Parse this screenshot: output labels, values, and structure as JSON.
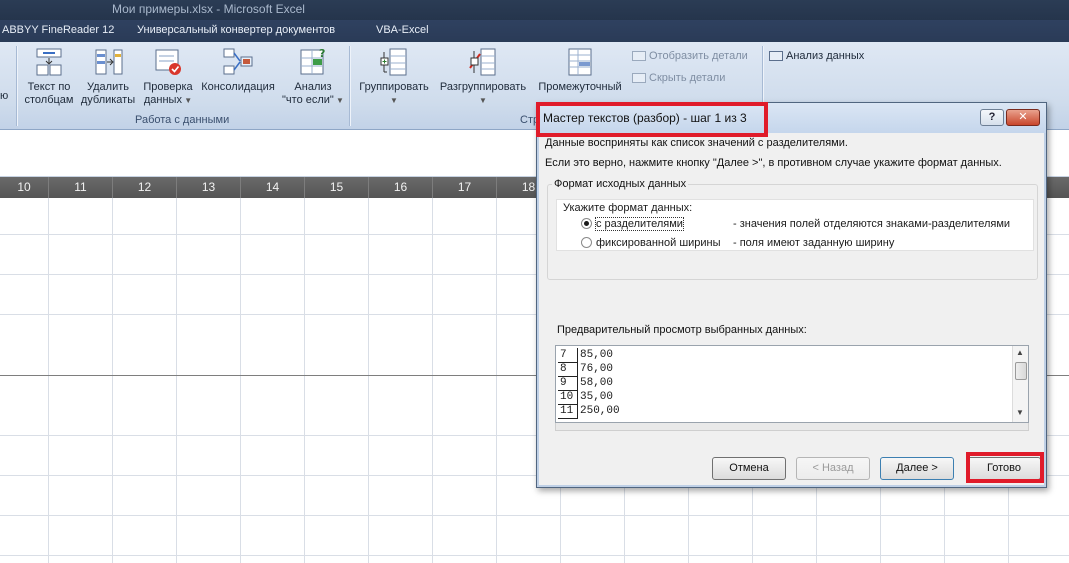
{
  "window": {
    "title": "Мои примеры.xlsx  -  Microsoft Excel",
    "tabs": [
      "ABBYY FineReader 12",
      "Универсальный конвертер документов",
      "VBA-Excel"
    ]
  },
  "ribbon": {
    "partial_left": "ю",
    "data_tools": {
      "text_to_columns": [
        "Текст по",
        "столбцам"
      ],
      "remove_duplicates": [
        "Удалить",
        "дубликаты"
      ],
      "data_validation": [
        "Проверка",
        "данных"
      ],
      "consolidate": "Консолидация",
      "what_if": [
        "Анализ",
        "\"что если\""
      ],
      "group_label": "Работа с данными"
    },
    "outline": {
      "group": "Группировать",
      "ungroup": "Разгруппировать",
      "subtotal": "Промежуточный",
      "show_detail": "Отобразить детали",
      "hide_detail": "Скрыть детали",
      "group_label_partial": "Стр"
    },
    "analysis": {
      "data_analysis": "Анализ данных"
    }
  },
  "columns": [
    "10",
    "11",
    "12",
    "13",
    "14",
    "15",
    "16",
    "17",
    "18"
  ],
  "dialog": {
    "title": "Мастер текстов (разбор) - шаг 1 из 3",
    "help": "?",
    "close": "✕",
    "line1": "Данные восприняты как список значений с разделителями.",
    "line2": "Если это верно, нажмите кнопку \"Далее >\", в противном случае укажите формат данных.",
    "group_title": "Формат исходных данных",
    "format_prompt": "Укажите формат данных:",
    "options": [
      {
        "label": "с разделителями",
        "desc": "- значения полей отделяются знаками-разделителями",
        "selected": true
      },
      {
        "label": "фиксированной ширины",
        "desc": "- поля имеют заданную ширину",
        "selected": false
      }
    ],
    "preview_label": "Предварительный просмотр выбранных данных:",
    "preview_rows": [
      {
        "n": "7",
        "v": "85,00"
      },
      {
        "n": "8",
        "v": "76,00"
      },
      {
        "n": "9",
        "v": "58,00"
      },
      {
        "n": "10",
        "v": "35,00"
      },
      {
        "n": "11",
        "v": "250,00"
      }
    ],
    "buttons": {
      "cancel": "Отмена",
      "back": "< Назад",
      "next": "Далее >",
      "finish": "Готово"
    }
  },
  "colors": {
    "highlight": "#e01b2a",
    "ribbon": "#cfdcec",
    "title_bar": "#2b3c55"
  }
}
